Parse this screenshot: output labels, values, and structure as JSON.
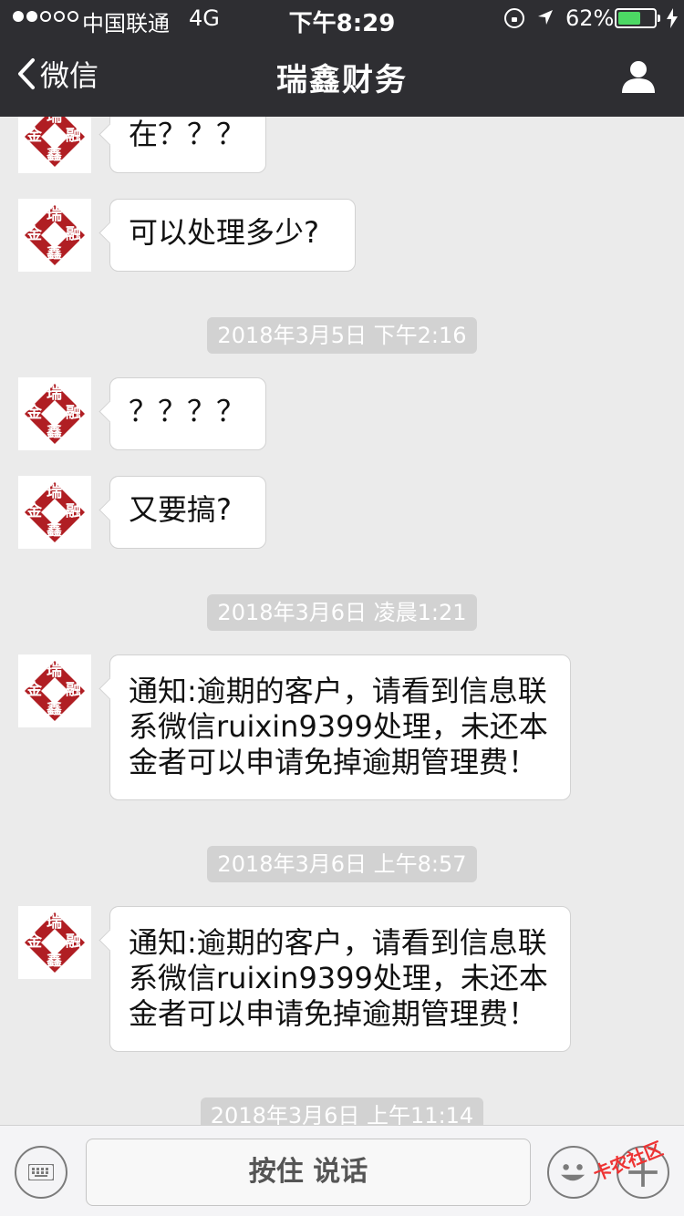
{
  "status_bar": {
    "carrier": "中国联通",
    "network": "4G",
    "time": "下午8:29",
    "battery": "62%",
    "battery_level": 0.62,
    "signal_bars": 2
  },
  "nav": {
    "back_label": "微信",
    "title": "瑞鑫财务"
  },
  "avatar": {
    "top": "瑞",
    "left": "金",
    "right": "融",
    "bottom": "鑫",
    "color": "#b01e23"
  },
  "messages": [
    {
      "type": "text",
      "text": "在？？？"
    },
    {
      "type": "text",
      "text": "可以处理多少?"
    },
    {
      "type": "time",
      "text": "2018年3月5日 下午2:16"
    },
    {
      "type": "text",
      "text": "？？？？"
    },
    {
      "type": "text",
      "text": "又要搞?"
    },
    {
      "type": "time",
      "text": "2018年3月6日 凌晨1:21"
    },
    {
      "type": "text",
      "lines": [
        "通知:逾期的客户，请看到信息联",
        "系微信ruixin9399处理，未还本",
        "金者可以申请免掉逾期管理费！"
      ]
    },
    {
      "type": "time",
      "text": "2018年3月6日 上午8:57"
    },
    {
      "type": "text",
      "lines": [
        "通知:逾期的客户，请看到信息联",
        "系微信ruixin9399处理，未还本",
        "金者可以申请免掉逾期管理费！"
      ]
    },
    {
      "type": "time",
      "text": "2018年3月6日 上午11:14"
    }
  ],
  "input_bar": {
    "hold_to_talk": "按住 说话"
  },
  "watermark": "卡农社区"
}
